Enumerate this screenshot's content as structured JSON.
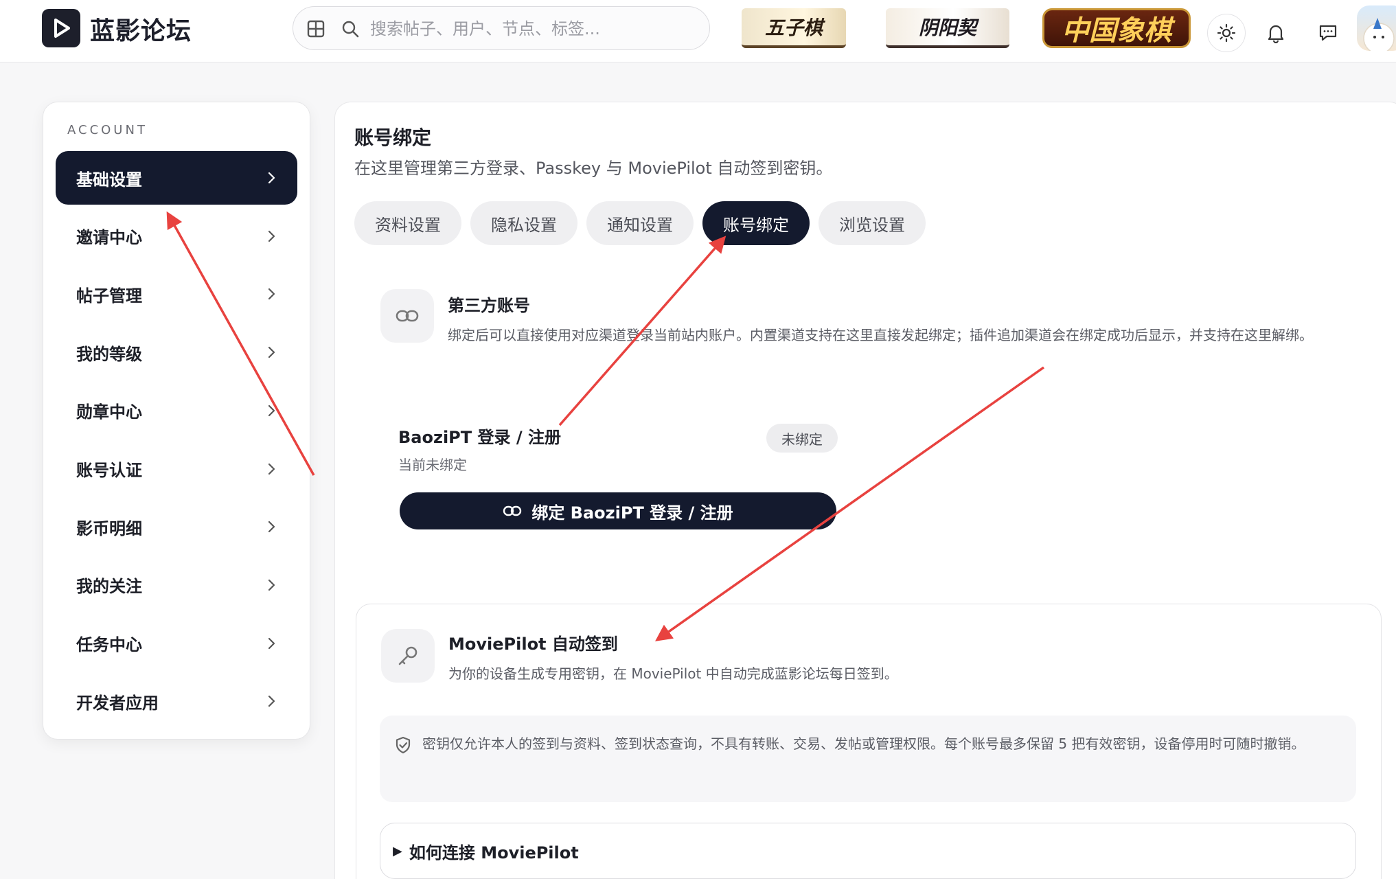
{
  "header": {
    "brand": "蓝影论坛",
    "search_placeholder": "搜索帖子、用户、节点、标签...",
    "games": [
      "五子棋",
      "阴阳契",
      "中国象棋"
    ]
  },
  "sidebar": {
    "heading": "ACCOUNT",
    "items": [
      {
        "label": "基础设置",
        "active": true
      },
      {
        "label": "邀请中心"
      },
      {
        "label": "帖子管理"
      },
      {
        "label": "我的等级"
      },
      {
        "label": "勋章中心"
      },
      {
        "label": "账号认证"
      },
      {
        "label": "影币明细"
      },
      {
        "label": "我的关注"
      },
      {
        "label": "任务中心"
      },
      {
        "label": "开发者应用"
      }
    ]
  },
  "main": {
    "title": "账号绑定",
    "subtitle": "在这里管理第三方登录、Passkey 与 MoviePilot 自动签到密钥。",
    "tabs": [
      "资料设置",
      "隐私设置",
      "通知设置",
      "账号绑定",
      "浏览设置"
    ],
    "active_tab": "账号绑定",
    "third_party": {
      "title": "第三方账号",
      "desc": "绑定后可以直接使用对应渠道登录当前站内账户。内置渠道支持在这里直接发起绑定；插件追加渠道会在绑定成功后显示，并支持在这里解绑。",
      "provider_name": "BaoziPT 登录 / 注册",
      "provider_status": "当前未绑定",
      "badge": "未绑定",
      "bind_button": "绑定 BaoziPT 登录 / 注册"
    },
    "moviepilot": {
      "title": "MoviePilot 自动签到",
      "desc": "为你的设备生成专用密钥，在 MoviePilot 中自动完成蓝影论坛每日签到。",
      "notice": "密钥仅允许本人的签到与资料、签到状态查询，不具有转账、交易、发帖或管理权限。每个账号最多保留 5 把有效密钥，设备停用时可随时撤销。",
      "details_label": "如何连接 MoviePilot"
    }
  },
  "colors": {
    "primary_dark": "#141a2e",
    "annotation_arrow": "#e8423f"
  }
}
